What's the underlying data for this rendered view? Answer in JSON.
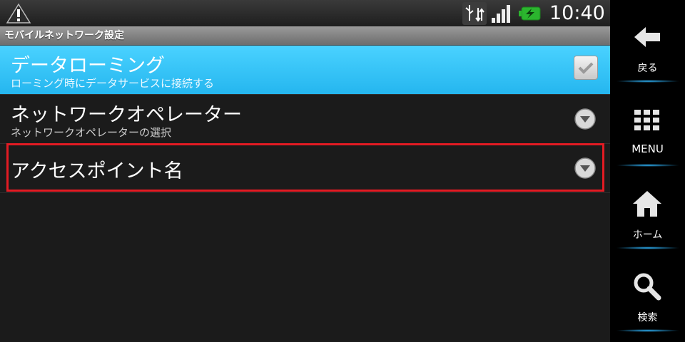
{
  "status_bar": {
    "time": "10:40",
    "icons": [
      "warning-icon",
      "usb-debug-icon",
      "signal-icon",
      "battery-charging-icon"
    ]
  },
  "title": "モバイルネットワーク設定",
  "settings": [
    {
      "title": "データローミング",
      "subtitle": "ローミング時にデータサービスに接続する",
      "control": "checkbox",
      "checked": true
    },
    {
      "title": "ネットワークオペレーター",
      "subtitle": "ネットワークオペレーターの選択",
      "control": "chevron-down-icon"
    },
    {
      "title": "アクセスポイント名",
      "control": "chevron-down-icon"
    }
  ],
  "nav": {
    "back": "戻る",
    "menu": "MENU",
    "home": "ホーム",
    "search": "検索"
  },
  "colors": {
    "selected_row": "#33c4f5",
    "highlight_box": "#e31b23",
    "nav_glow": "#2fb7ff"
  }
}
